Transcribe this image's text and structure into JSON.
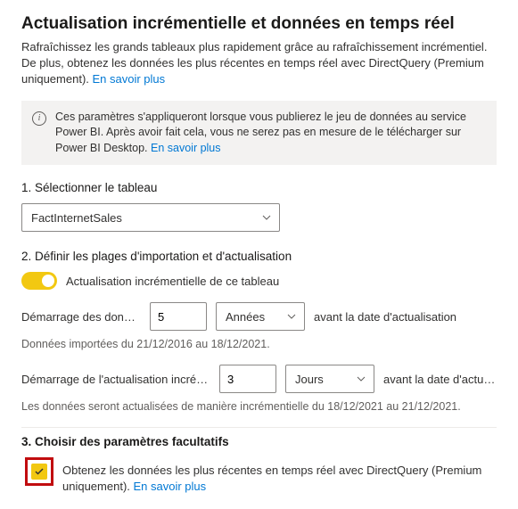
{
  "title": "Actualisation incrémentielle et données en temps réel",
  "subtitle_prefix": "Rafraîchissez les grands tableaux plus rapidement grâce au rafraîchissement incrémentiel. De plus, obtenez les données les plus récentes en temps réel avec DirectQuery (Premium uniquement). ",
  "learn_more": "En savoir plus",
  "info_box_prefix": "Ces paramètres s'appliqueront lorsque vous publierez le jeu de données au service Power BI. Après avoir fait cela, vous ne serez pas en mesure de le télécharger sur Power BI Desktop. ",
  "step1": {
    "label": "1. Sélectionner le tableau",
    "selected": "FactInternetSales"
  },
  "step2": {
    "label": "2. Définir les plages d'importation et d'actualisation",
    "toggle_label": "Actualisation incrémentielle de ce tableau",
    "toggle_on": true,
    "archive": {
      "label": "Démarrage des données",
      "value": "5",
      "unit": "Années",
      "suffix": "avant la date d'actualisation"
    },
    "archive_hint": "Données importées du 21/12/2016 au 18/12/2021.",
    "incremental": {
      "label": "Démarrage de l'actualisation incrémentielle",
      "value": "3",
      "unit": "Jours",
      "suffix": "avant la date d'actualisation"
    },
    "incremental_hint": "Les données seront actualisées de manière incrémentielle du 18/12/2021 au 21/12/2021."
  },
  "step3": {
    "label": "3. Choisir des paramètres facultatifs",
    "checkbox_checked": true,
    "checkbox_text_prefix": "Obtenez les données les plus récentes en temps réel avec DirectQuery (Premium uniquement). "
  }
}
